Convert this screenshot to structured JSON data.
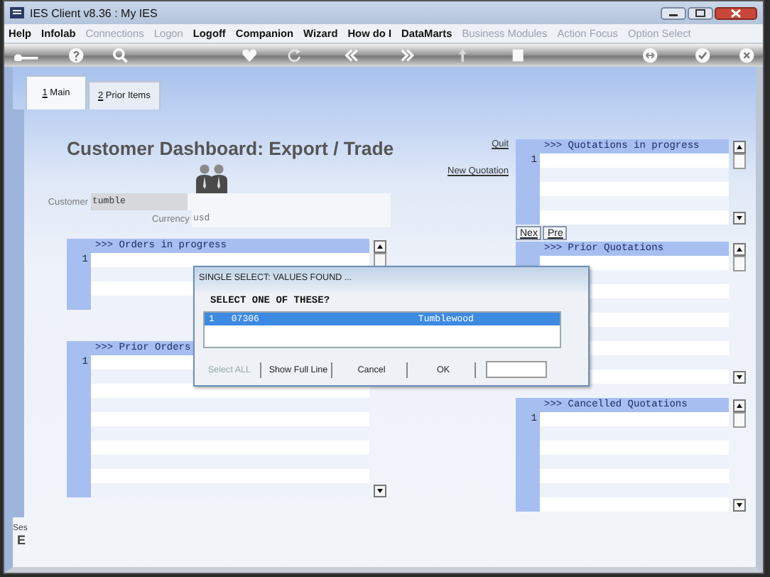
{
  "window": {
    "title": "IES Client v8.36 : My IES"
  },
  "menu": [
    {
      "label": "Help",
      "disabled": false
    },
    {
      "label": "Infolab",
      "disabled": false
    },
    {
      "label": "Connections",
      "disabled": true
    },
    {
      "label": "Logon",
      "disabled": true
    },
    {
      "label": "Logoff",
      "disabled": false
    },
    {
      "label": "Companion",
      "disabled": false
    },
    {
      "label": "Wizard",
      "disabled": false
    },
    {
      "label": "How do I",
      "disabled": false
    },
    {
      "label": "DataMarts",
      "disabled": false
    },
    {
      "label": "Business Modules",
      "disabled": true
    },
    {
      "label": "Action Focus",
      "disabled": true
    },
    {
      "label": "Option Select",
      "disabled": true
    }
  ],
  "tabs": [
    {
      "label": "1 Main",
      "selected": true
    },
    {
      "label": "2 Prior Items",
      "selected": false
    }
  ],
  "form": {
    "title": "Customer Dashboard: Export / Trade",
    "customer": {
      "label": "Customer",
      "value": "tumble"
    },
    "currency": {
      "label": "Currency",
      "value": "usd"
    }
  },
  "links": [
    "Quit",
    "New Quotation"
  ],
  "left_panels": [
    {
      "header": ">>> Orders in progress",
      "row_number": "1"
    },
    {
      "header": ">>> Prior Orders",
      "row_number": "1"
    }
  ],
  "right_panels": [
    {
      "header": ">>> Quotations in progress",
      "row_number": "1",
      "pager": [
        "Nex",
        "Pre"
      ]
    },
    {
      "header": ">>> Prior Quotations"
    },
    {
      "header": ">>> Cancelled Quotations",
      "row_number": "1"
    }
  ],
  "side": [
    "Ses",
    "E"
  ],
  "dialog": {
    "title": "SINGLE SELECT: VALUES FOUND ...",
    "prompt": "SELECT ONE OF THESE?",
    "rows": [
      {
        "number": "1",
        "code": "07306",
        "name": "Tumblewood",
        "selected": true
      }
    ],
    "buttons": [
      {
        "label": "Select ALL",
        "disabled": true
      },
      {
        "label": "Show Full Line",
        "disabled": false
      },
      {
        "label": "Cancel",
        "disabled": false
      },
      {
        "label": "OK",
        "disabled": false
      }
    ]
  }
}
